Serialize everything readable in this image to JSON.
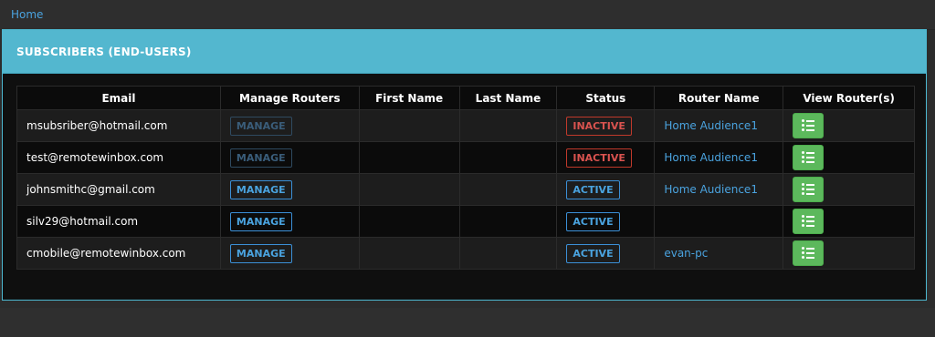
{
  "breadcrumb": {
    "home_label": "Home"
  },
  "panel": {
    "title": "SUBSCRIBERS (END-USERS)"
  },
  "table": {
    "headers": {
      "email": "Email",
      "manage": "Manage Routers",
      "first_name": "First Name",
      "last_name": "Last Name",
      "status": "Status",
      "router_name": "Router Name",
      "view": "View Router(s)"
    },
    "rows": [
      {
        "email": "msubsriber@hotmail.com",
        "manage_label": "MANAGE",
        "manage_enabled": false,
        "first_name": "",
        "last_name": "",
        "status": "INACTIVE",
        "router_name": "Home Audience1"
      },
      {
        "email": "test@remotewinbox.com",
        "manage_label": "MANAGE",
        "manage_enabled": false,
        "first_name": "",
        "last_name": "",
        "status": "INACTIVE",
        "router_name": "Home Audience1"
      },
      {
        "email": "johnsmithc@gmail.com",
        "manage_label": "MANAGE",
        "manage_enabled": true,
        "first_name": "",
        "last_name": "",
        "status": "ACTIVE",
        "router_name": "Home Audience1"
      },
      {
        "email": "silv29@hotmail.com",
        "manage_label": "MANAGE",
        "manage_enabled": true,
        "first_name": "",
        "last_name": "",
        "status": "ACTIVE",
        "router_name": ""
      },
      {
        "email": "cmobile@remotewinbox.com",
        "manage_label": "MANAGE",
        "manage_enabled": true,
        "first_name": "",
        "last_name": "",
        "status": "ACTIVE",
        "router_name": "evan-pc"
      }
    ],
    "view_icon": "list-icon"
  },
  "colors": {
    "panel_heading": "#53b7cf",
    "link": "#4aa3df",
    "inactive": "#d9534f",
    "view_button": "#5cb85c"
  }
}
